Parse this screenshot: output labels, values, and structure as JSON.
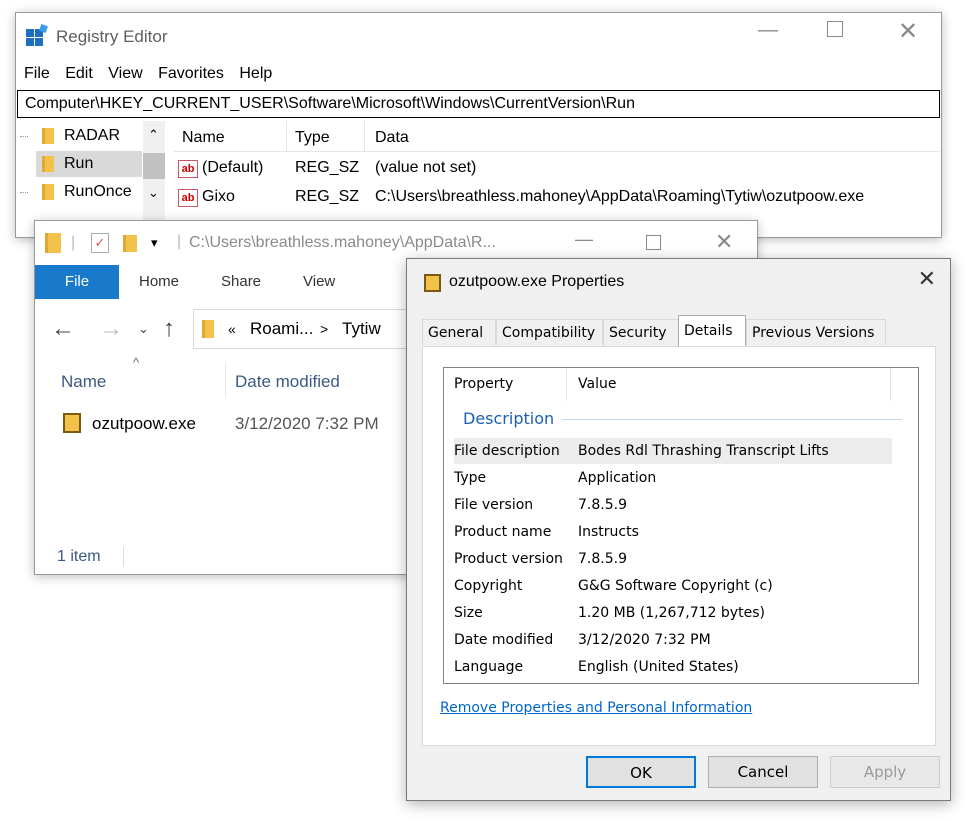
{
  "registry": {
    "title": "Registry Editor",
    "menu": [
      "File",
      "Edit",
      "View",
      "Favorites",
      "Help"
    ],
    "address": "Computer\\HKEY_CURRENT_USER\\Software\\Microsoft\\Windows\\CurrentVersion\\Run",
    "tree": [
      "RADAR",
      "Run",
      "RunOnce"
    ],
    "columns": [
      "Name",
      "Type",
      "Data"
    ],
    "rows": [
      {
        "name": "(Default)",
        "type": "REG_SZ",
        "data": "(value not set)"
      },
      {
        "name": "Gixo",
        "type": "REG_SZ",
        "data": "C:\\Users\\breathless.mahoney\\AppData\\Roaming\\Tytiw\\ozutpoow.exe"
      }
    ]
  },
  "explorer": {
    "title_path": "C:\\Users\\breathless.mahoney\\AppData\\R...",
    "ribbon_tabs": [
      "File",
      "Home",
      "Share",
      "View"
    ],
    "breadcrumb": [
      "«",
      "Roami...",
      ">",
      "Tytiw"
    ],
    "col_name": "Name",
    "col_date": "Date modified",
    "file": {
      "name": "ozutpoow.exe",
      "date": "3/12/2020 7:32 PM"
    },
    "status": "1 item"
  },
  "properties": {
    "title": "ozutpoow.exe Properties",
    "tabs": [
      "General",
      "Compatibility",
      "Security",
      "Details",
      "Previous Versions"
    ],
    "active_tab": "Details",
    "col_property": "Property",
    "col_value": "Value",
    "section": "Description",
    "rows": [
      {
        "k": "File description",
        "v": "Bodes Rdl Thrashing Transcript Lifts"
      },
      {
        "k": "Type",
        "v": "Application"
      },
      {
        "k": "File version",
        "v": "7.8.5.9"
      },
      {
        "k": "Product name",
        "v": "Instructs"
      },
      {
        "k": "Product version",
        "v": "7.8.5.9"
      },
      {
        "k": "Copyright",
        "v": "G&G Software Copyright (c)"
      },
      {
        "k": "Size",
        "v": "1.20 MB (1,267,712 bytes)"
      },
      {
        "k": "Date modified",
        "v": "3/12/2020 7:32 PM"
      },
      {
        "k": "Language",
        "v": "English (United States)"
      }
    ],
    "link": "Remove Properties and Personal Information",
    "buttons": {
      "ok": "OK",
      "cancel": "Cancel",
      "apply": "Apply"
    }
  },
  "colors": {
    "accent": "#1979ca",
    "link": "#0066cc",
    "folder": "#f3c24a"
  }
}
